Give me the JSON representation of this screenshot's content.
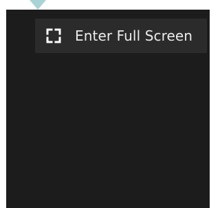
{
  "menu": {
    "fullscreen_label": "Enter Full Screen",
    "fullscreen_icon": "fullscreen-icon"
  },
  "colors": {
    "panel_background": "#1c1c1c",
    "button_background": "#2b2b2b",
    "text": "#ececec",
    "pointer": "#a9d3d6"
  }
}
